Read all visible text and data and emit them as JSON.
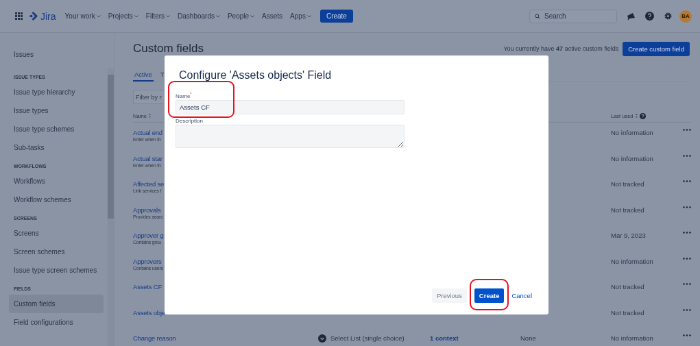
{
  "topbar": {
    "product": "Jira",
    "nav": [
      {
        "label": "Your work",
        "has_menu": true
      },
      {
        "label": "Projects",
        "has_menu": true
      },
      {
        "label": "Filters",
        "has_menu": true
      },
      {
        "label": "Dashboards",
        "has_menu": true
      },
      {
        "label": "People",
        "has_menu": true
      },
      {
        "label": "Assets",
        "has_menu": false
      },
      {
        "label": "Apps",
        "has_menu": true
      }
    ],
    "create_label": "Create",
    "search": {
      "placeholder": "Search"
    },
    "avatar": "BA"
  },
  "sidebar": {
    "title": "Issues",
    "sections": [
      {
        "heading": "ISSUE TYPES",
        "items": [
          {
            "label": "Issue type hierarchy",
            "selected": false
          },
          {
            "label": "Issue types",
            "selected": false
          },
          {
            "label": "Issue type schemes",
            "selected": false
          },
          {
            "label": "Sub-tasks",
            "selected": false
          }
        ]
      },
      {
        "heading": "WORKFLOWS",
        "items": [
          {
            "label": "Workflows",
            "selected": false
          },
          {
            "label": "Workflow schemes",
            "selected": false
          }
        ]
      },
      {
        "heading": "SCREENS",
        "items": [
          {
            "label": "Screens",
            "selected": false
          },
          {
            "label": "Screen schemes",
            "selected": false
          },
          {
            "label": "Issue type screen schemes",
            "selected": false
          }
        ]
      },
      {
        "heading": "FIELDS",
        "items": [
          {
            "label": "Custom fields",
            "selected": true
          },
          {
            "label": "Field configurations",
            "selected": false
          }
        ]
      }
    ]
  },
  "page": {
    "title": "Custom fields",
    "summary": "You currently have **47** active custom fields",
    "create_button": "Create custom field",
    "tabs": [
      {
        "label": "Active",
        "selected": true
      },
      {
        "label": "T",
        "selected": false
      }
    ],
    "filter": {
      "placeholder": "Filter by n"
    },
    "columns": {
      "name": "Name",
      "last_used": "Last used"
    },
    "rows": [
      {
        "name": "Actual end",
        "description": "Enter when th",
        "last_used": "No information"
      },
      {
        "name": "Actual star",
        "description": "Enter when th",
        "last_used": "No information"
      },
      {
        "name": "Affected se",
        "description": "Link services f",
        "last_used": "Not tracked"
      },
      {
        "name": "Approvals",
        "description": "Provides searc",
        "last_used": "Not tracked"
      },
      {
        "name": "Approver g",
        "description": "Contains grou",
        "last_used": "Mar 9, 2023"
      },
      {
        "name": "Approvers",
        "description": "Contains users",
        "last_used": "No information"
      },
      {
        "name": "Assets CF",
        "last_used": "Not tracked"
      },
      {
        "name": "Assets obje",
        "last_used": "Not tracked"
      },
      {
        "name": "Change reason",
        "type": "Select List (single choice)",
        "contexts": "1 context",
        "screens": "None",
        "last_used": "No information"
      }
    ]
  },
  "dialog": {
    "title": "Configure 'Assets objects' Field",
    "fields": [
      {
        "kind": "input",
        "label": "Name",
        "required_mark": "*",
        "value": "Assets CF",
        "highlighted": true
      },
      {
        "kind": "textarea",
        "label": "Description",
        "highlighted": false
      }
    ],
    "buttons": [
      {
        "kind": "subtle",
        "label": "Previous",
        "highlighted": false
      },
      {
        "kind": "primary",
        "label": "Create",
        "highlighted": true
      },
      {
        "kind": "link",
        "label": "Cancel",
        "highlighted": false
      }
    ]
  }
}
